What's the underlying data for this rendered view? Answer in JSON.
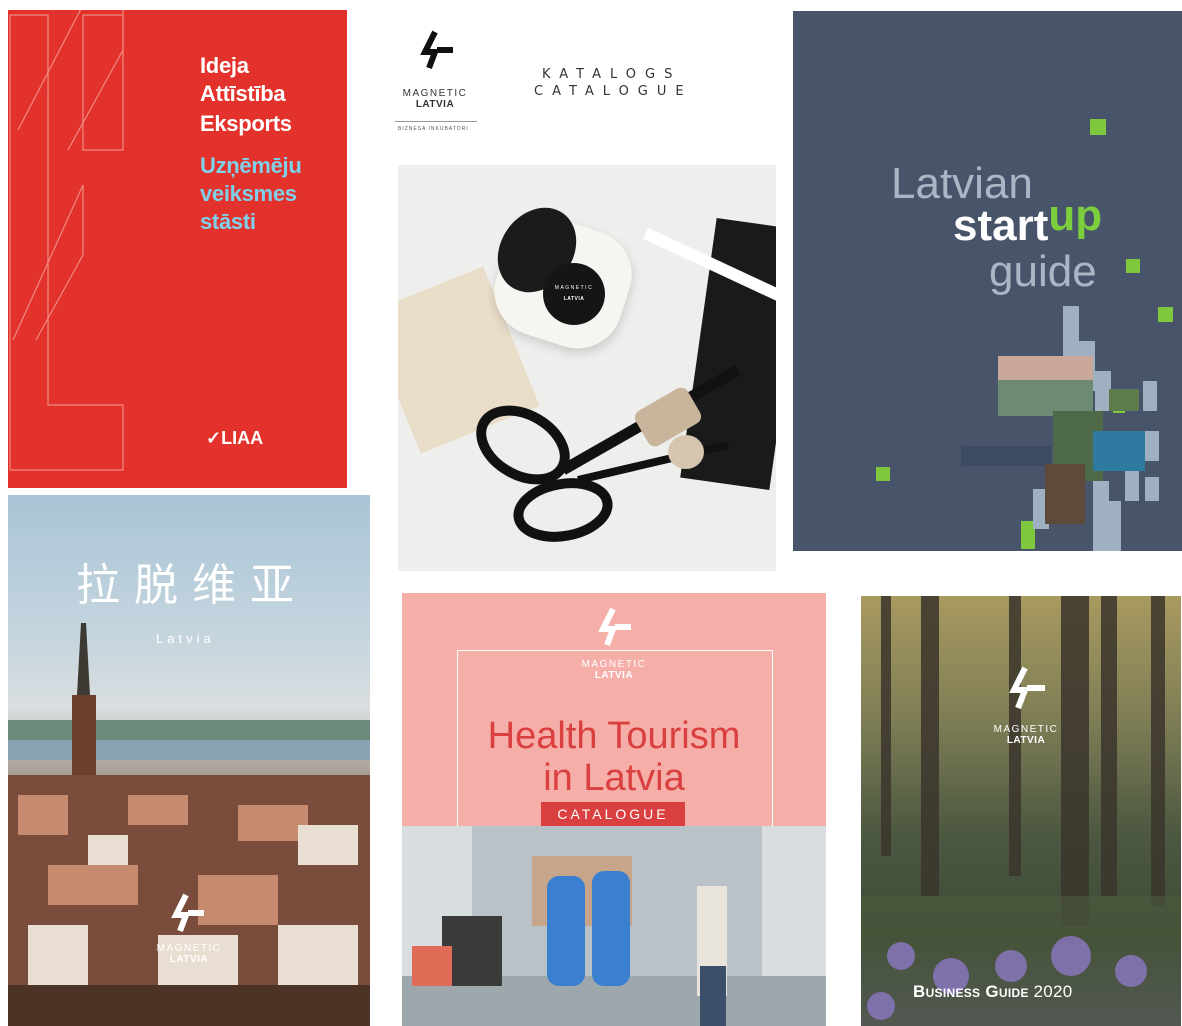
{
  "liaa": {
    "line1": "Ideja",
    "line2": "Attīstība",
    "line3": "Eksports",
    "line4": "Uzņēmēju",
    "line5": "veiksmes",
    "line6": "stāsti",
    "logo": "LIAA"
  },
  "catalogue": {
    "brand1": "MAGNETIC",
    "brand2": "LATVIA",
    "sub": "BIZNESA INKUBATORI",
    "title1": "KATALOGS",
    "title2": "CATALOGUE",
    "cup1": "MAGNETIC",
    "cup2": "LATVIA"
  },
  "startup": {
    "w1": "Latvian",
    "w2": "start",
    "w3": "up",
    "w4": "guide"
  },
  "china": {
    "title": "拉脱维亚",
    "sub": "Latvia",
    "brand1": "MAGNETIC",
    "brand2": "LATVIA"
  },
  "health": {
    "brand1": "MAGNETIC",
    "brand2": "LATVIA",
    "title1": "Health Tourism",
    "title2": "in Latvia",
    "badge": "CATALOGUE"
  },
  "business": {
    "brand1": "MAGNETIC",
    "brand2": "LATVIA",
    "title": "Business Guide",
    "year": "2020"
  }
}
